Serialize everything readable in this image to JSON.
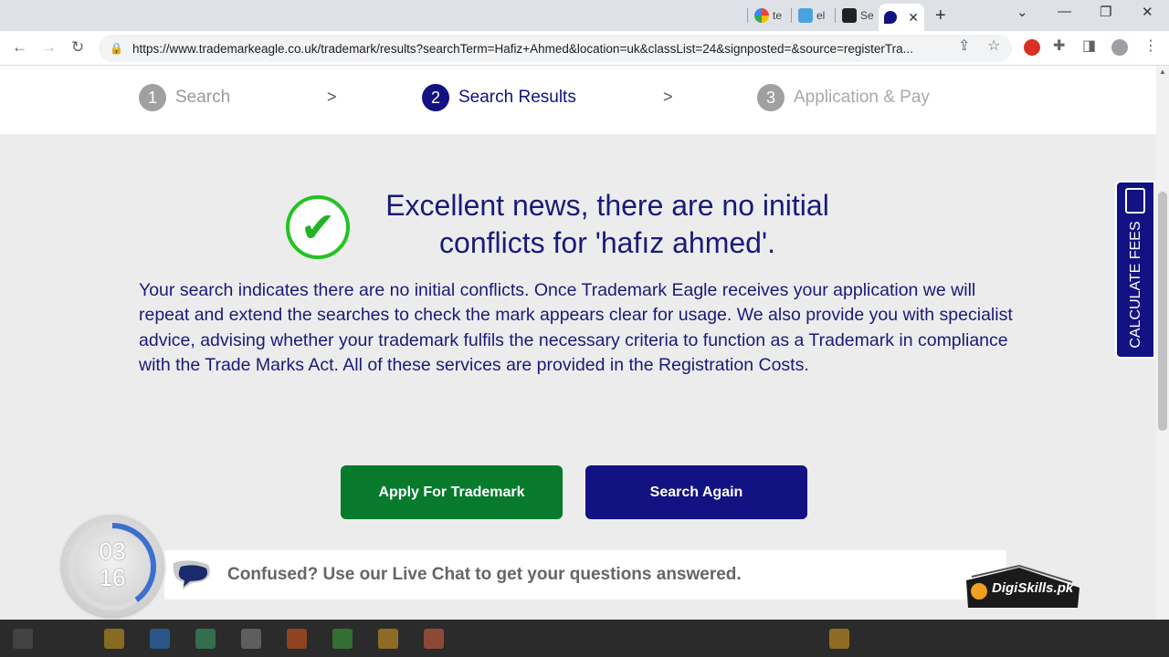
{
  "browser": {
    "tabs": [
      {
        "label": "te",
        "icon": "google-icon"
      },
      {
        "label": "el",
        "icon": "cart-icon"
      },
      {
        "label": "Se",
        "icon": "site-icon"
      }
    ],
    "active_tab_icon": "eagle-icon",
    "url": "https://www.trademarkeagle.co.uk/trademark/results?searchTerm=Hafiz+Ahmed&location=uk&classList=24&signposted=&source=registerTra..."
  },
  "steps": [
    {
      "num": "1",
      "label": "Search"
    },
    {
      "num": "2",
      "label": "Search Results"
    },
    {
      "num": "3",
      "label": "Application & Pay"
    }
  ],
  "step_separator": ">",
  "colors": {
    "primary": "#121282",
    "success": "#087a2c",
    "check": "#22c422"
  },
  "result": {
    "headline_line1": "Excellent news, there are no initial",
    "headline_line2": "conflicts for 'hafız ahmed'.",
    "body": "Your search indicates there are no initial conflicts. Once Trademark Eagle receives your application we will repeat and extend the searches to check the mark appears clear for usage. We also provide you with specialist advice, advising whether your trademark fulfils the necessary criteria to function as a Trademark in compliance with the Trade Marks Act. All of these services are provided in the Registration Costs."
  },
  "buttons": {
    "apply": "Apply For Trademark",
    "search_again": "Search Again"
  },
  "chat": {
    "text": "Confused? Use our Live Chat to get your questions answered."
  },
  "sidebar": {
    "calculate_fees": "CALCULATE FEES"
  },
  "timer": {
    "line1": "03",
    "line2": "16",
    "progress": 0.4
  },
  "watermark": {
    "logo": "DigiSkills.pk"
  }
}
